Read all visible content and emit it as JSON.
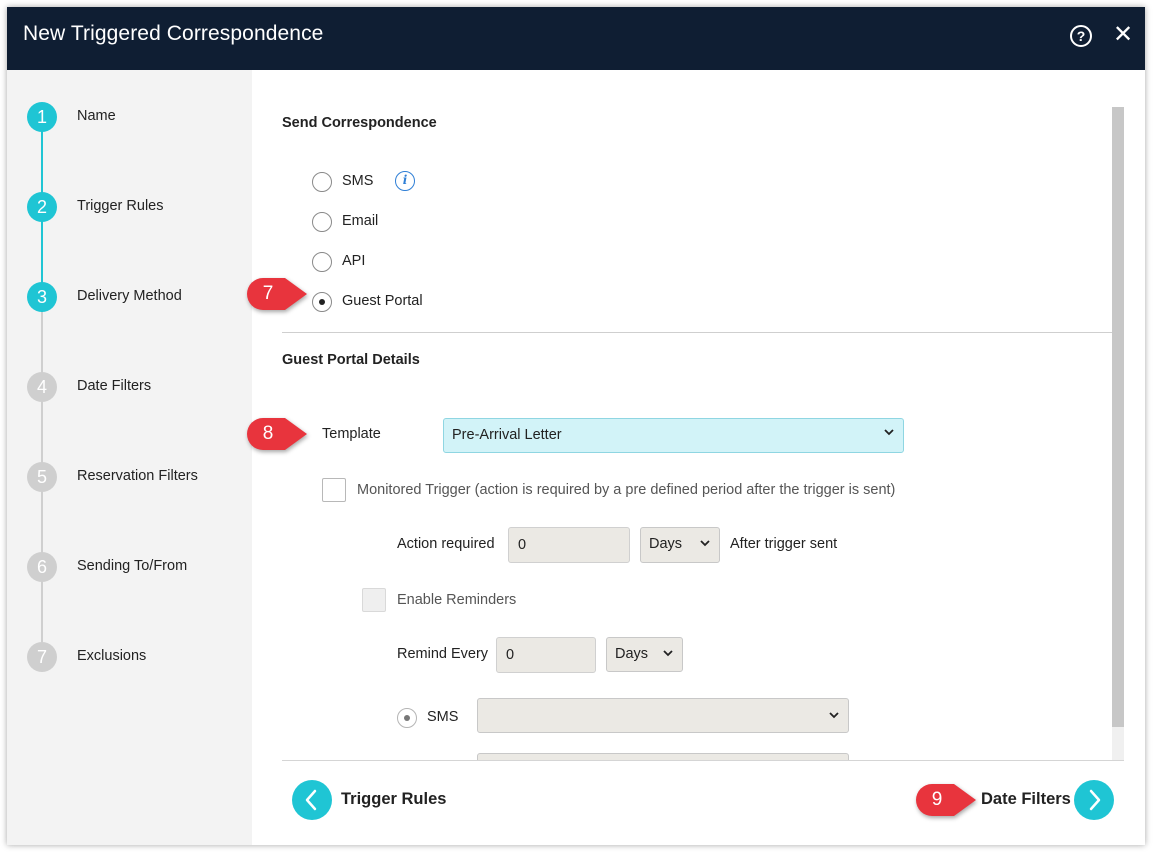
{
  "window": {
    "title": "New Triggered Correspondence",
    "help_icon": "?",
    "close_icon": "✕"
  },
  "steps": [
    {
      "number": "1",
      "label": "Name",
      "state": "active"
    },
    {
      "number": "2",
      "label": "Trigger Rules",
      "state": "active"
    },
    {
      "number": "3",
      "label": "Delivery Method",
      "state": "active"
    },
    {
      "number": "4",
      "label": "Date Filters",
      "state": "inactive"
    },
    {
      "number": "5",
      "label": "Reservation Filters",
      "state": "inactive"
    },
    {
      "number": "6",
      "label": "Sending To/From",
      "state": "inactive"
    },
    {
      "number": "7",
      "label": "Exclusions",
      "state": "inactive"
    }
  ],
  "send_correspondence": {
    "title": "Send Correspondence",
    "options": [
      {
        "label": "SMS",
        "selected": false
      },
      {
        "label": "Email",
        "selected": false
      },
      {
        "label": "API",
        "selected": false
      },
      {
        "label": "Guest Portal",
        "selected": true
      }
    ],
    "info_icon": "i"
  },
  "guest_portal": {
    "title": "Guest Portal Details",
    "template_label": "Template",
    "template_value": "Pre-Arrival Letter",
    "monitored_label": "Monitored Trigger (action is required by a pre defined period after the trigger is sent)",
    "monitored_checked": false,
    "action_required_label": "Action required",
    "action_required_value": "0",
    "action_unit": "Days",
    "after_label": "After trigger sent",
    "enable_reminders_label": "Enable Reminders",
    "remind_every_label": "Remind Every",
    "remind_every_value": "0",
    "remind_unit": "Days",
    "reminder_channel_label": "SMS",
    "reminder_channel_value": ""
  },
  "footer": {
    "prev_label": "Trigger Rules",
    "next_label": "Date Filters"
  },
  "callouts": [
    "7",
    "8",
    "9"
  ],
  "colors": {
    "title_bar": "#0f1e33",
    "accent": "#1fc5d4",
    "callout": "#e8343d",
    "template_bg": "#d2f3f8"
  }
}
